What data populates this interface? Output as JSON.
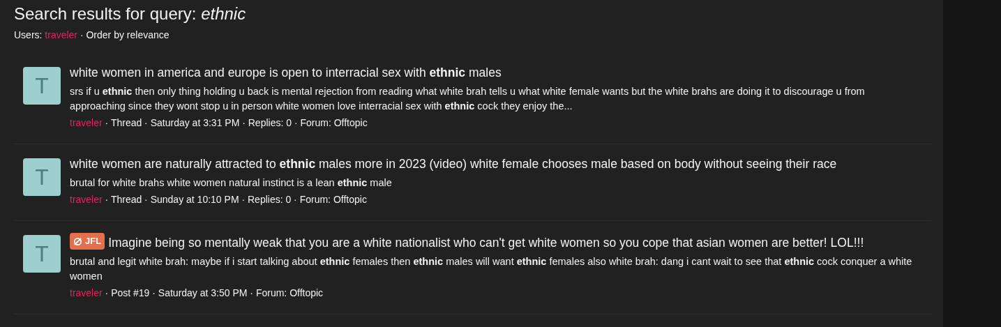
{
  "heading": "Search results for query: *ethnic*",
  "filters": {
    "label": "Users:",
    "user": "traveler",
    "order": "· Order by relevance"
  },
  "results": [
    {
      "avatar_letter": "T",
      "title": "white women in america and europe is open to interracial sex with **ethnic** males",
      "snippet": "srs if u **ethnic** then only thing holding u back is mental rejection from reading what white brah tells u what white female wants but the white brahs are doing it to discourage u from approaching since they wont stop u in person white women love interracial sex with **ethnic** cock they enjoy the...",
      "user": "traveler",
      "meta": " · Thread · Saturday at 3:31 PM · Replies: 0 · Forum: Offtopic"
    },
    {
      "avatar_letter": "T",
      "title": "white women are naturally attracted to **ethnic** males more in 2023 (video) white female chooses male based on body without seeing their race",
      "snippet": "brutal for white brahs white women natural instinct is a lean **ethnic** male",
      "user": "traveler",
      "meta": " · Thread · Sunday at 10:10 PM · Replies: 0 · Forum: Offtopic"
    },
    {
      "avatar_letter": "T",
      "prefix": {
        "label": "JFL",
        "color": "#e2704f"
      },
      "title": "Imagine being so mentally weak that you are a white nationalist who can't get white women so you cope that asian women are better! LOL!!!",
      "snippet": "brutal and legit white brah: maybe if i start talking about **ethnic** females then **ethnic** males will want **ethnic** females also white brah: dang i cant wait to see that **ethnic** cock conquer a white women",
      "user": "traveler",
      "meta": " · Post #19 · Saturday at 3:50 PM · Forum: Offtopic"
    }
  ]
}
